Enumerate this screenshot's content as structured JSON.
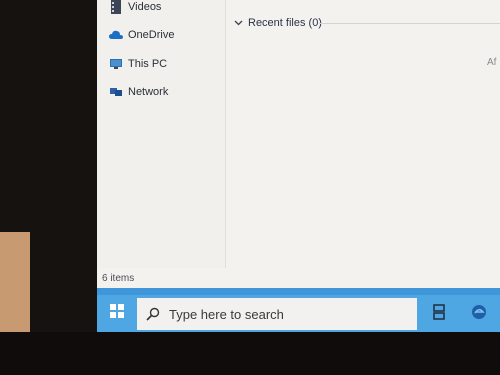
{
  "navigation": {
    "items": [
      {
        "label": "Videos",
        "icon": "videos-folder-icon"
      },
      {
        "label": "OneDrive",
        "icon": "onedrive-cloud-icon"
      },
      {
        "label": "This PC",
        "icon": "this-pc-icon"
      },
      {
        "label": "Network",
        "icon": "network-icon"
      }
    ]
  },
  "content": {
    "section_title": "Recent files (0)",
    "column_header_partial": "Af"
  },
  "status_bar": {
    "item_count": "6 items"
  },
  "taskbar": {
    "search_placeholder": "Type here to search"
  },
  "colors": {
    "taskbar": "#4ea6e3",
    "onedrive": "#1d6fc4"
  }
}
